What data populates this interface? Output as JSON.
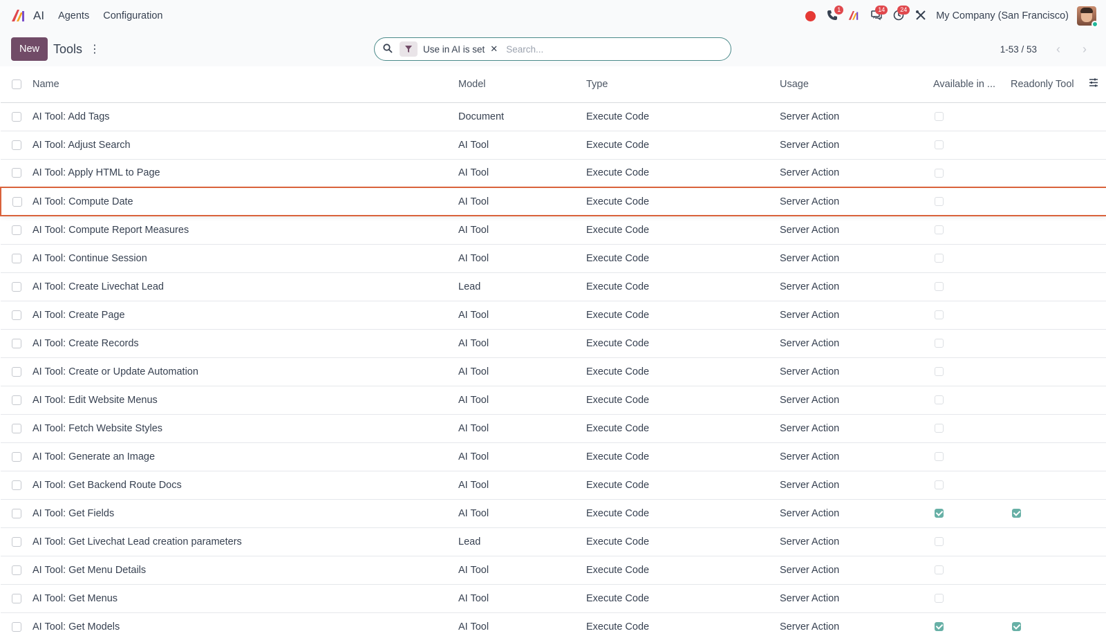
{
  "navbar": {
    "brand": "AI",
    "menu": [
      "Agents",
      "Configuration"
    ],
    "badges": {
      "phone": "1",
      "discuss": "14",
      "activities": "24"
    },
    "company": "My Company (San Francisco)"
  },
  "control": {
    "new_label": "New",
    "breadcrumb": "Tools",
    "facet_label": "Use in AI is set",
    "facet_remove": "✕",
    "search_placeholder": "Search...",
    "pager_value": "1-53 / 53"
  },
  "table": {
    "headers": [
      "Name",
      "Model",
      "Type",
      "Usage",
      "Available in ...",
      "Readonly Tool"
    ],
    "highlight_row": 3,
    "rows": [
      {
        "name": "AI Tool: Add Tags",
        "model": "Document",
        "type": "Execute Code",
        "usage": "Server Action",
        "available": false,
        "readonly": null
      },
      {
        "name": "AI Tool: Adjust Search",
        "model": "AI Tool",
        "type": "Execute Code",
        "usage": "Server Action",
        "available": false,
        "readonly": null
      },
      {
        "name": "AI Tool: Apply HTML to Page",
        "model": "AI Tool",
        "type": "Execute Code",
        "usage": "Server Action",
        "available": false,
        "readonly": null
      },
      {
        "name": "AI Tool: Compute Date",
        "model": "AI Tool",
        "type": "Execute Code",
        "usage": "Server Action",
        "available": false,
        "readonly": null
      },
      {
        "name": "AI Tool: Compute Report Measures",
        "model": "AI Tool",
        "type": "Execute Code",
        "usage": "Server Action",
        "available": false,
        "readonly": null
      },
      {
        "name": "AI Tool: Continue Session",
        "model": "AI Tool",
        "type": "Execute Code",
        "usage": "Server Action",
        "available": false,
        "readonly": null
      },
      {
        "name": "AI Tool: Create Livechat Lead",
        "model": "Lead",
        "type": "Execute Code",
        "usage": "Server Action",
        "available": false,
        "readonly": null
      },
      {
        "name": "AI Tool: Create Page",
        "model": "AI Tool",
        "type": "Execute Code",
        "usage": "Server Action",
        "available": false,
        "readonly": null
      },
      {
        "name": "AI Tool: Create Records",
        "model": "AI Tool",
        "type": "Execute Code",
        "usage": "Server Action",
        "available": false,
        "readonly": null
      },
      {
        "name": "AI Tool: Create or Update Automation",
        "model": "AI Tool",
        "type": "Execute Code",
        "usage": "Server Action",
        "available": false,
        "readonly": null
      },
      {
        "name": "AI Tool: Edit Website Menus",
        "model": "AI Tool",
        "type": "Execute Code",
        "usage": "Server Action",
        "available": false,
        "readonly": null
      },
      {
        "name": "AI Tool: Fetch Website Styles",
        "model": "AI Tool",
        "type": "Execute Code",
        "usage": "Server Action",
        "available": false,
        "readonly": null
      },
      {
        "name": "AI Tool: Generate an Image",
        "model": "AI Tool",
        "type": "Execute Code",
        "usage": "Server Action",
        "available": false,
        "readonly": null
      },
      {
        "name": "AI Tool: Get Backend Route Docs",
        "model": "AI Tool",
        "type": "Execute Code",
        "usage": "Server Action",
        "available": false,
        "readonly": null
      },
      {
        "name": "AI Tool: Get Fields",
        "model": "AI Tool",
        "type": "Execute Code",
        "usage": "Server Action",
        "available": true,
        "readonly": true
      },
      {
        "name": "AI Tool: Get Livechat Lead creation parameters",
        "model": "Lead",
        "type": "Execute Code",
        "usage": "Server Action",
        "available": false,
        "readonly": null
      },
      {
        "name": "AI Tool: Get Menu Details",
        "model": "AI Tool",
        "type": "Execute Code",
        "usage": "Server Action",
        "available": false,
        "readonly": null
      },
      {
        "name": "AI Tool: Get Menus",
        "model": "AI Tool",
        "type": "Execute Code",
        "usage": "Server Action",
        "available": false,
        "readonly": null
      },
      {
        "name": "AI Tool: Get Models",
        "model": "AI Tool",
        "type": "Execute Code",
        "usage": "Server Action",
        "available": true,
        "readonly": true
      }
    ]
  },
  "colors": {
    "primary": "#714b67",
    "highlight_border": "#d9623b",
    "checked": "#67b0a6",
    "badge": "#e0484d"
  }
}
